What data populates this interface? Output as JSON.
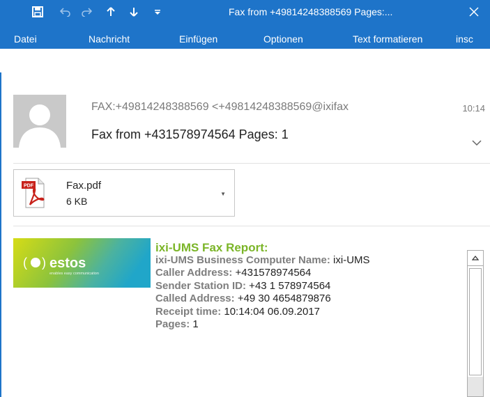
{
  "window": {
    "title": "Fax from +49814248388569 Pages:...",
    "colors": {
      "titlebar": "#1e74c9",
      "text_on_titlebar": "#ffffff",
      "report_title": "#7bb528"
    }
  },
  "quick_access": [
    {
      "name": "save-icon"
    },
    {
      "name": "undo-icon"
    },
    {
      "name": "redo-icon"
    },
    {
      "name": "previous-item-icon"
    },
    {
      "name": "next-item-icon"
    },
    {
      "name": "customize-qat-icon"
    }
  ],
  "menu": {
    "items": [
      "Datei",
      "Nachricht",
      "Einfügen",
      "Optionen",
      "Text formatieren",
      "insc"
    ]
  },
  "header": {
    "from": "FAX:+49814248388569 <+49814248388569@ixifax",
    "time": "10:14",
    "subject": "Fax from +431578974564 Pages: 1"
  },
  "attachment": {
    "name": "Fax.pdf",
    "size": "6 KB",
    "icon_label": "PDF"
  },
  "logo": {
    "text": "estos",
    "tagline": "enables easy communication"
  },
  "report": {
    "title": "ixi-UMS Fax Report:",
    "rows": [
      {
        "label": "ixi-UMS Business Computer Name:",
        "value": " ixi-UMS"
      },
      {
        "label": "Caller Address:",
        "value": " +431578974564"
      },
      {
        "label": "Sender Station ID:",
        "value": " +43 1 578974564"
      },
      {
        "label": "Called Address:",
        "value": " +49 30 4654879876"
      },
      {
        "label": "Receipt time:",
        "value": " 10:14:04 06.09.2017"
      },
      {
        "label": "Pages:",
        "value": " 1"
      }
    ]
  }
}
